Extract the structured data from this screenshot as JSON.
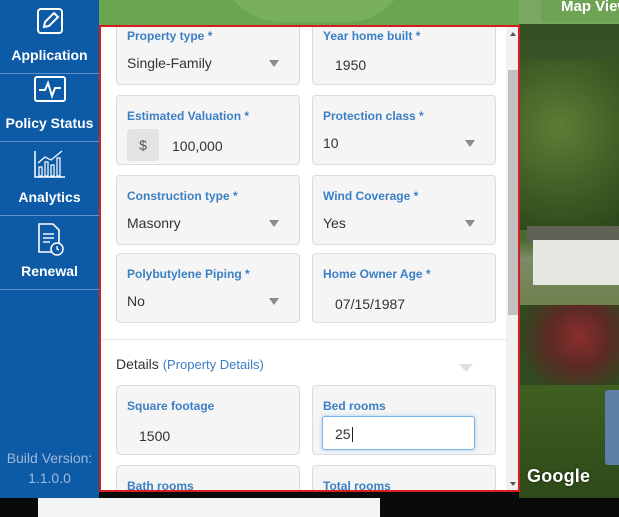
{
  "sidebar": {
    "items": [
      {
        "label": "Application",
        "icon": "edit-icon"
      },
      {
        "label": "Policy Status",
        "icon": "pulse-monitor-icon"
      },
      {
        "label": "Analytics",
        "icon": "bar-chart-icon"
      },
      {
        "label": "Renewal",
        "icon": "document-clock-icon"
      }
    ],
    "build_label": "Build Version:",
    "build_number": "1.1.0.0"
  },
  "map": {
    "tab_label": "Map View",
    "watermark": "Google"
  },
  "form": {
    "property_type": {
      "label": "Property type *",
      "value": "Single-Family"
    },
    "year_built": {
      "label": "Year home built *",
      "value": "1950"
    },
    "valuation": {
      "label": "Estimated Valuation *",
      "prefix": "$",
      "value": "100,000"
    },
    "protection_class": {
      "label": "Protection class *",
      "value": "10"
    },
    "construction_type": {
      "label": "Construction type *",
      "value": "Masonry"
    },
    "wind_coverage": {
      "label": "Wind Coverage *",
      "value": "Yes"
    },
    "polybutylene": {
      "label": "Polybutylene Piping *",
      "value": "No"
    },
    "owner_age": {
      "label": "Home Owner Age *",
      "value": "07/15/1987"
    },
    "details": {
      "title": "Details",
      "subtitle": "(Property Details)"
    },
    "square_footage": {
      "label": "Square footage",
      "value": "1500"
    },
    "bed_rooms": {
      "label": "Bed rooms",
      "value": "25"
    },
    "bath_rooms": {
      "label": "Bath rooms"
    },
    "total_rooms": {
      "label": "Total rooms"
    }
  },
  "colors": {
    "sidebar": "#0d5aa7",
    "label_blue": "#3b7fc4",
    "panel_border": "#d71d1d"
  }
}
